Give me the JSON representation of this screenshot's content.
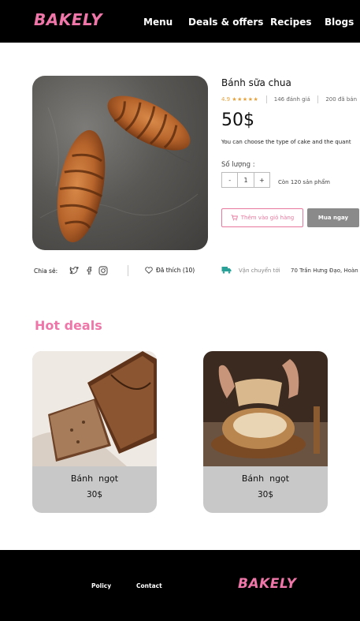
{
  "brand": {
    "logo_text": "BAKELY",
    "accent": "#ef76a8"
  },
  "nav": {
    "items": [
      {
        "label": "Menu"
      },
      {
        "label": "Deals & offers"
      },
      {
        "label": "Recipes"
      },
      {
        "label": "Blogs"
      }
    ]
  },
  "product": {
    "title": "Bánh sữa chua",
    "rating": "4.9",
    "stars": "★★★★★",
    "reviews": "146 đánh giá",
    "sold": "200 đã bán",
    "price": "50$",
    "description": "You can choose the type of cake and the quant",
    "quantity_label": "Số lượng :",
    "quantity_minus": "-",
    "quantity_value": "1",
    "quantity_plus": "+",
    "stock": "Còn 120 sản phẩm",
    "add_to_cart_label": "Thêm vào giỏ hàng",
    "buy_now_label": "Mua ngay",
    "share_label": "Chia sẻ:",
    "liked_label": "Đã thích (10)",
    "shipping_label": "Vận chuyển tới",
    "shipping_address": "70 Trần Hưng Đạo, Hoàn"
  },
  "hot_deals": {
    "title": "Hot deals",
    "cards": [
      {
        "name": "Bánh  ngọt",
        "price": "30$"
      },
      {
        "name": "Bánh  ngọt",
        "price": "30$"
      }
    ]
  },
  "footer": {
    "links": [
      {
        "label": "Policy"
      },
      {
        "label": "Contact"
      }
    ],
    "logo_text": "BAKELY"
  }
}
